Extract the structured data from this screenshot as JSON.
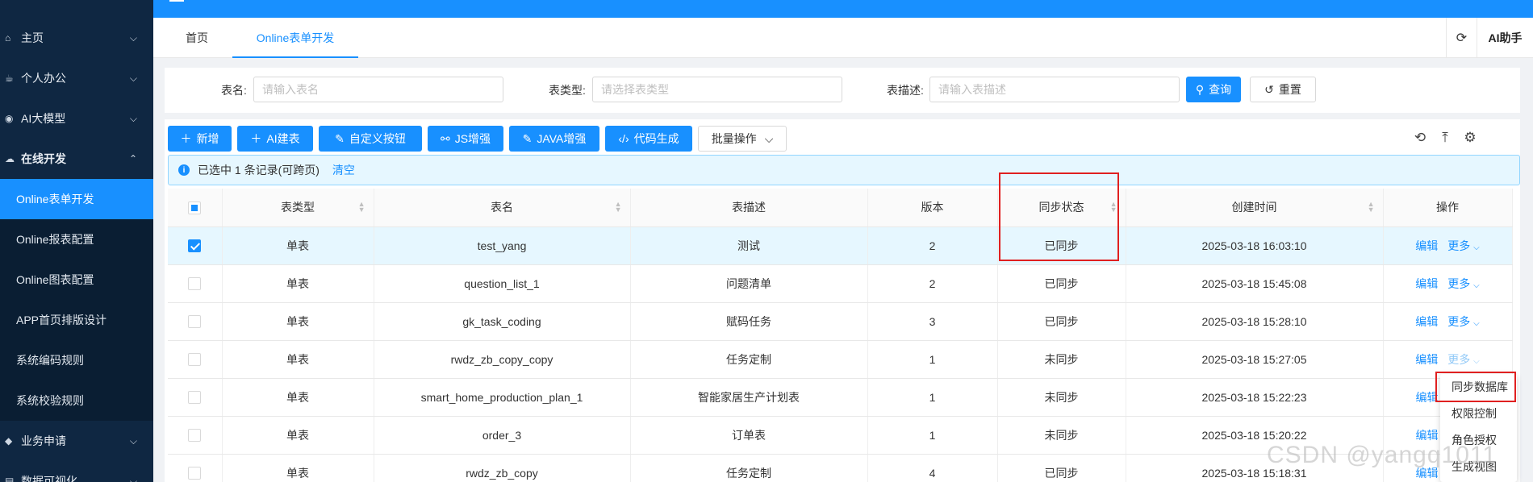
{
  "sidebar": {
    "items": [
      {
        "label": "主页",
        "icon": "home-icon"
      },
      {
        "label": "个人办公",
        "icon": "coffee-icon"
      },
      {
        "label": "AI大模型",
        "icon": "ai-icon"
      },
      {
        "label": "在线开发",
        "icon": "cloud-icon"
      },
      {
        "label": "业务申请",
        "icon": "tag-icon"
      },
      {
        "label": "数据可视化",
        "icon": "chart-icon"
      }
    ],
    "sub_items": [
      {
        "label": "Online表单开发",
        "active": true
      },
      {
        "label": "Online报表配置"
      },
      {
        "label": "Online图表配置"
      },
      {
        "label": "APP首页排版设计"
      },
      {
        "label": "系统编码规则"
      },
      {
        "label": "系统校验规则"
      }
    ]
  },
  "tabs": [
    {
      "label": "首页"
    },
    {
      "label": "Online表单开发",
      "active": true
    }
  ],
  "header": {
    "ai_help": "AI助手"
  },
  "search": {
    "table_name_label": "表名:",
    "table_name_placeholder": "请输入表名",
    "table_type_label": "表类型:",
    "table_type_placeholder": "请选择表类型",
    "table_desc_label": "表描述:",
    "table_desc_placeholder": "请输入表描述",
    "query_label": "查询",
    "reset_label": "重置"
  },
  "toolbar": {
    "add": "新增",
    "ai_build": "AI建表",
    "custom_button": "自定义按钮",
    "js_enhance": "JS增强",
    "java_enhance": "JAVA增强",
    "code_gen": "代码生成",
    "batch": "批量操作"
  },
  "alert": {
    "text": "已选中 1 条记录(可跨页)",
    "clear": "清空"
  },
  "table": {
    "headers": [
      "表类型",
      "表名",
      "表描述",
      "版本",
      "同步状态",
      "创建时间",
      "操作"
    ],
    "edit_label": "编辑",
    "more_label": "更多",
    "rows": [
      {
        "type": "单表",
        "name": "test_yang",
        "desc": "测试",
        "version": "2",
        "status": "已同步",
        "synced": true,
        "created": "2025-03-18 16:03:10",
        "checked": true
      },
      {
        "type": "单表",
        "name": "question_list_1",
        "desc": "问题清单",
        "version": "2",
        "status": "已同步",
        "synced": true,
        "created": "2025-03-18 15:45:08"
      },
      {
        "type": "单表",
        "name": "gk_task_coding",
        "desc": "赋码任务",
        "version": "3",
        "status": "已同步",
        "synced": true,
        "created": "2025-03-18 15:28:10"
      },
      {
        "type": "单表",
        "name": "rwdz_zb_copy_copy",
        "desc": "任务定制",
        "version": "1",
        "status": "未同步",
        "synced": false,
        "created": "2025-03-18 15:27:05"
      },
      {
        "type": "单表",
        "name": "smart_home_production_plan_1",
        "desc": "智能家居生产计划表",
        "version": "1",
        "status": "未同步",
        "synced": false,
        "created": "2025-03-18 15:22:23"
      },
      {
        "type": "单表",
        "name": "order_3",
        "desc": "订单表",
        "version": "1",
        "status": "未同步",
        "synced": false,
        "created": "2025-03-18 15:20:22"
      },
      {
        "type": "单表",
        "name": "rwdz_zb_copy",
        "desc": "任务定制",
        "version": "4",
        "status": "已同步",
        "synced": true,
        "created": "2025-03-18 15:18:31"
      }
    ]
  },
  "more_menu": {
    "items": [
      "同步数据库",
      "权限控制",
      "角色授权",
      "生成视图"
    ]
  },
  "watermark": "CSDN @yangq1011",
  "colors": {
    "primary": "#1890ff",
    "sidebar_bg": "#0f2742",
    "synced": "#52c41a",
    "unsynced": "#f5222d",
    "highlight": "#e02020"
  }
}
